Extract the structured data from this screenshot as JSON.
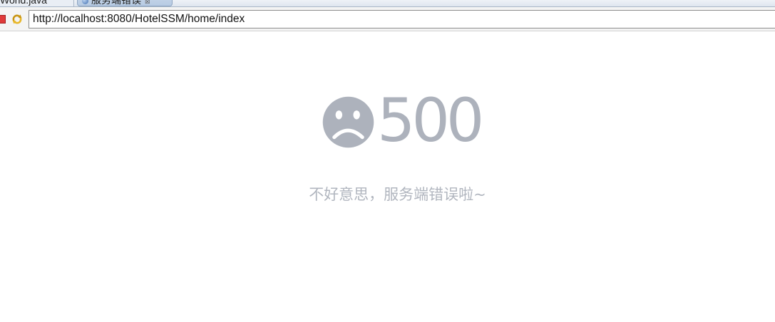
{
  "tabs": [
    {
      "label": "World.java",
      "active": false
    },
    {
      "label": "服务端错误",
      "active": true,
      "close_glyph": "⊠"
    }
  ],
  "address_bar": {
    "url": "http://localhost:8080/HotelSSM/home/index"
  },
  "toolbar_icons": [
    "stop-icon",
    "refresh-icon"
  ],
  "error": {
    "code": "500",
    "message": "不好意思，服务端错误啦~",
    "icon": "sad-face-icon"
  },
  "colors": {
    "error_text": "#adb2bc",
    "stop_red": "#e03a3a",
    "tab_active": "#c9d8ea"
  }
}
